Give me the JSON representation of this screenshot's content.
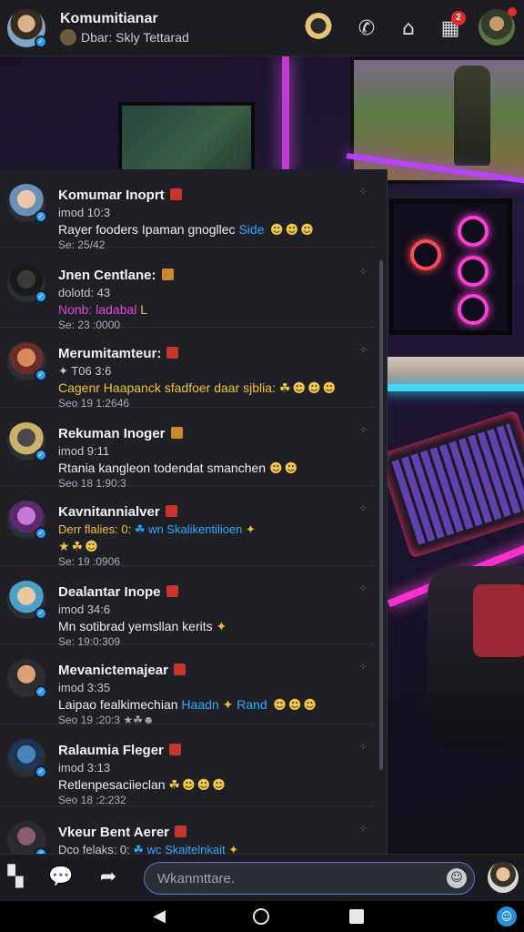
{
  "header": {
    "title": "Komumitianar",
    "subtitle": "Dbar: Skly Tettarad",
    "icons": {
      "phone": "phone-icon",
      "home": "home-icon",
      "store": "store-icon"
    },
    "notification_count": "2"
  },
  "chats": [
    {
      "name": "Komumar Inoprt",
      "sub": "imod 10:3",
      "msg_parts": [
        {
          "text": "Rayer fooders Ipaman gnogllec ",
          "color": ""
        },
        {
          "text": "Side",
          "color": "blue"
        },
        {
          "text": " ☻☻☻",
          "color": "emoji"
        }
      ],
      "time": "Se: 25/42",
      "tag": "red",
      "avatar_colors": [
        "#e9c9a8",
        "#6b8fb6"
      ]
    },
    {
      "name": "Jnen Centlane:",
      "sub": "dolotd: 43",
      "msg_parts": [
        {
          "text": "Nonb: ladabal ",
          "color": "pink"
        },
        {
          "text": "L",
          "color": "gold"
        }
      ],
      "time": "Se: 23 :0000",
      "tag": "gold",
      "avatar_colors": [
        "#3a3a3a",
        "#1a1a1a"
      ]
    },
    {
      "name": "Merumitamteur:",
      "sub": "✦ T06 3:6",
      "msg_parts": [
        {
          "text": "Cagenr Haapanck sfadfoer daar sjblia: ",
          "color": "gold"
        },
        {
          "text": "☘☻☻☻",
          "color": "emoji"
        }
      ],
      "time": "Seo 19 1:2646",
      "tag": "red",
      "avatar_colors": [
        "#d98a5a",
        "#6a2b2b"
      ]
    },
    {
      "name": "Rekuman Inoger",
      "sub": "imod 9:11",
      "msg_parts": [
        {
          "text": "Rtania kangleon todendat smanchen ",
          "color": ""
        },
        {
          "text": "☻☻",
          "color": "emoji"
        }
      ],
      "time": "Seo 18 1:90:3",
      "tag": "gold",
      "avatar_colors": [
        "#4a4a4a",
        "#c9b36a"
      ]
    },
    {
      "name": "Kavnitannialver",
      "sub_parts": [
        {
          "text": "Derr flalies: 0: ",
          "color": "gold"
        },
        {
          "text": "☘ wn Skalikentilioen ",
          "color": "blue"
        },
        {
          "text": "✦",
          "color": "gold"
        }
      ],
      "msg_parts": [
        {
          "text": "★☘☻",
          "color": "emoji"
        }
      ],
      "time": "Se: 19 :0906",
      "tag": "red",
      "avatar_colors": [
        "#c27ad6",
        "#5b2a6e"
      ]
    },
    {
      "name": "Dealantar Inope",
      "sub": "imod 34:6",
      "msg_parts": [
        {
          "text": "Mn sotibrad yemsllan kerits ",
          "color": ""
        },
        {
          "text": "✦",
          "color": "gold"
        }
      ],
      "time": "Se: 19:0:309",
      "tag": "red",
      "avatar_colors": [
        "#e8c7a5",
        "#4aa0c8"
      ]
    },
    {
      "name": "Mevanictemajear",
      "sub": "imod 3:35",
      "msg_parts": [
        {
          "text": "Laipao fealkimechian ",
          "color": ""
        },
        {
          "text": "Haadn",
          "color": "blue"
        },
        {
          "text": " ✦ ",
          "color": "gold"
        },
        {
          "text": "Rand",
          "color": "blue"
        },
        {
          "text": " ☻☻☻",
          "color": "emoji"
        }
      ],
      "time": "Seo 19 :20:3 ★☘☻",
      "tag": "red",
      "avatar_colors": [
        "#d9a07a",
        "#2c2c2c"
      ]
    },
    {
      "name": "Ralaumia Fleger",
      "sub": "imod 3:13",
      "msg_parts": [
        {
          "text": "Retlenpesaciieclan ",
          "color": ""
        },
        {
          "text": "☘☻☻☻",
          "color": "emoji"
        }
      ],
      "time": "Seo 18 :2:232",
      "tag": "red",
      "avatar_colors": [
        "#4a84b8",
        "#1e3450"
      ]
    },
    {
      "name": "Vkeur Bent Aerer",
      "sub_parts": [
        {
          "text": "Dco felaks: 0: ",
          "color": ""
        },
        {
          "text": "☘ wc Skaitelnkait ",
          "color": "blue"
        },
        {
          "text": "✦",
          "color": "gold"
        }
      ],
      "msg_parts": [],
      "time": "",
      "tag": "red",
      "avatar_colors": [
        "#8a5a6e",
        "#2a2a30"
      ]
    }
  ],
  "compose": {
    "placeholder": "Wkanmttare.",
    "icons": {
      "apps": "apps-icon",
      "chat": "chat-bubble-icon",
      "share": "share-icon",
      "emoji": "emoji-icon"
    }
  },
  "colors": {
    "blue": "#33a7ff",
    "pink": "#e04ad8",
    "gold": "#f0c03a",
    "emoji": "#f2c64a"
  }
}
